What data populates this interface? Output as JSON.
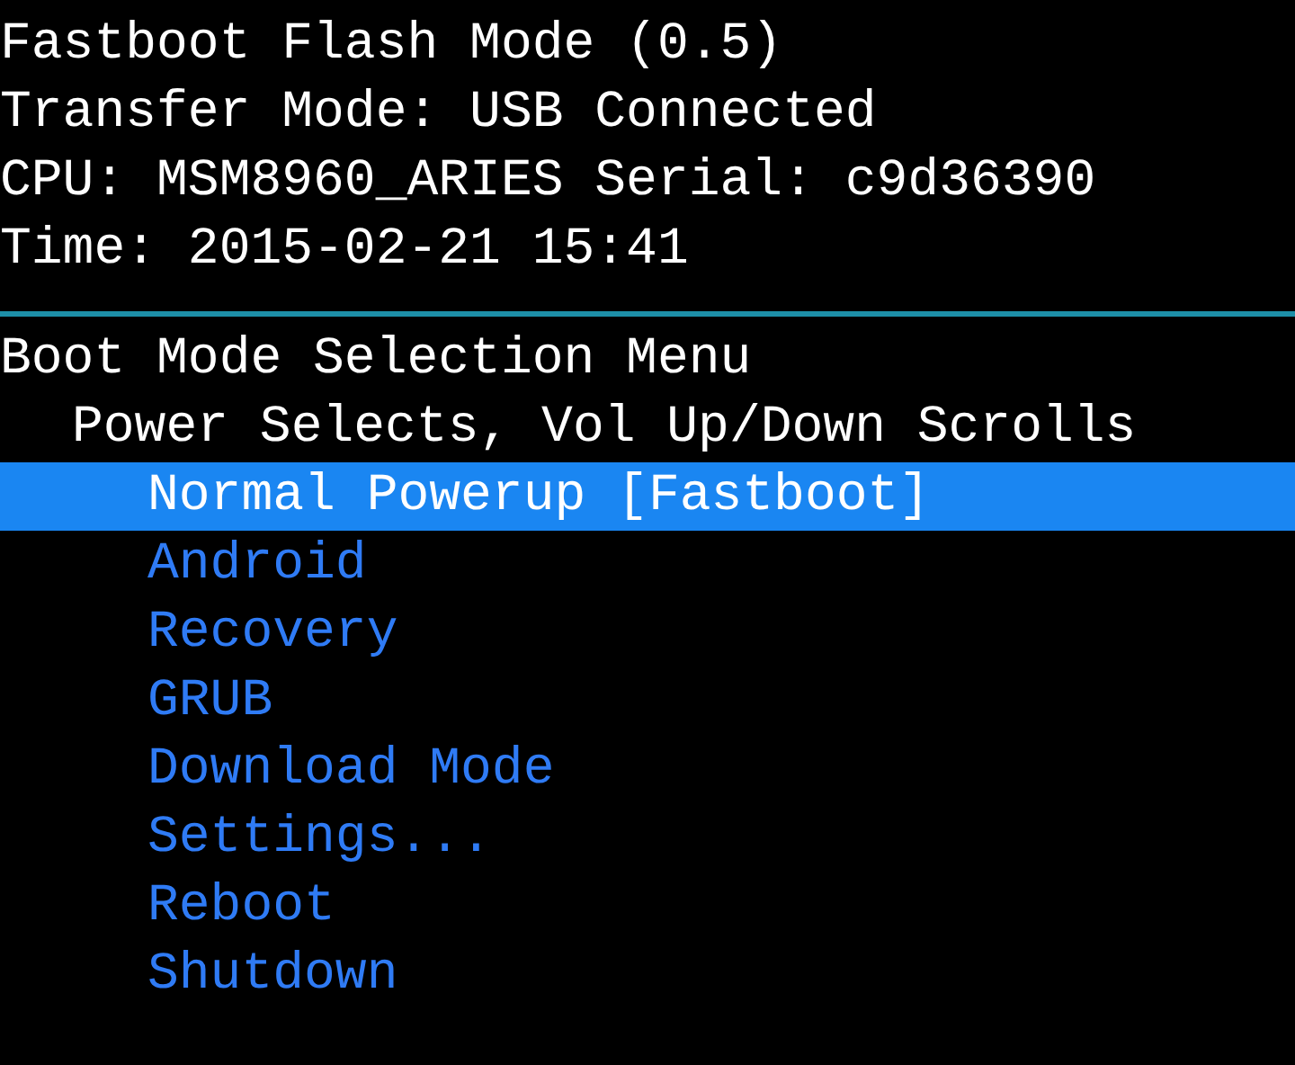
{
  "header": [
    "Fastboot Flash Mode (0.5)",
    "Transfer Mode: USB Connected",
    "CPU: MSM8960_ARIES Serial: c9d36390",
    "Time: 2015-02-21 15:41"
  ],
  "menu": {
    "title": "Boot Mode Selection Menu",
    "hint": "Power Selects, Vol Up/Down Scrolls",
    "items": [
      {
        "label": "Normal Powerup [Fastboot]",
        "selected": true
      },
      {
        "label": "Android",
        "selected": false
      },
      {
        "label": "Recovery",
        "selected": false
      },
      {
        "label": "GRUB",
        "selected": false
      },
      {
        "label": "Download Mode",
        "selected": false
      },
      {
        "label": "Settings...",
        "selected": false
      },
      {
        "label": "Reboot",
        "selected": false
      },
      {
        "label": "Shutdown",
        "selected": false
      }
    ]
  }
}
